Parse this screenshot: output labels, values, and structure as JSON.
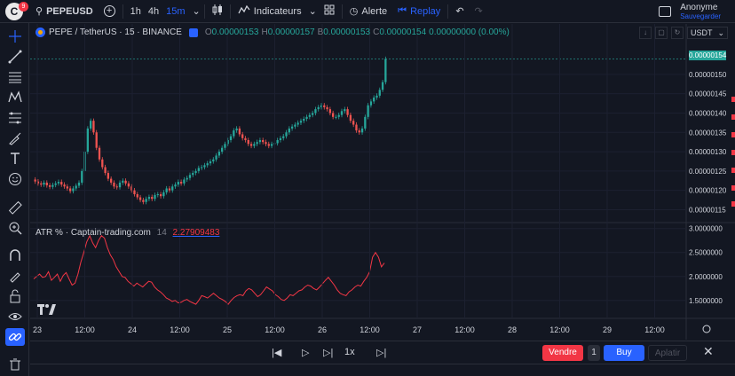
{
  "topbar": {
    "symbol": "PEPEUSD",
    "timeframes": [
      "1h",
      "4h",
      "15m"
    ],
    "indicators_label": "Indicateurs",
    "alert_label": "Alerte",
    "replay_label": "Replay",
    "user_name": "Anonyme",
    "user_sub": "Sauvegarder"
  },
  "legend": {
    "title": "PEPE / TetherUS · 15 · BINANCE",
    "o_label": "O",
    "o_val": "0.00000153",
    "h_label": "H",
    "h_val": "0.00000157",
    "b_label": "B",
    "b_val": "0.00000153",
    "c_label": "C",
    "c_val": "0.00000154",
    "change": "0.00000000 (0.00%)"
  },
  "indicator": {
    "name": "ATR % · Captain-trading.com",
    "length": "14",
    "value": "2.27909483"
  },
  "currency": "USDT",
  "price_tag": "0.00000154",
  "chart_data": [
    {
      "type": "candlestick",
      "title": "PEPE / TetherUS · 15 · BINANCE",
      "y_ticks": [
        "0.00000150",
        "0.00000145",
        "0.00000140",
        "0.00000135",
        "0.00000130",
        "0.00000125",
        "0.00000120",
        "0.00000115"
      ],
      "ylim": [
        1.135e-06,
        1.58e-06
      ],
      "x_ticks": [
        "23",
        "12:00",
        "24",
        "12:00",
        "25",
        "12:00",
        "26",
        "12:00",
        "27",
        "12:00",
        "28",
        "12:00",
        "29",
        "12:00"
      ],
      "close": [
        1.223,
        1.218,
        1.215,
        1.22,
        1.213,
        1.209,
        1.214,
        1.218,
        1.222,
        1.215,
        1.21,
        1.205,
        1.198,
        1.205,
        1.212,
        1.22,
        1.25,
        1.3,
        1.36,
        1.38,
        1.35,
        1.31,
        1.28,
        1.26,
        1.245,
        1.23,
        1.22,
        1.21,
        1.208,
        1.22,
        1.225,
        1.218,
        1.21,
        1.2,
        1.19,
        1.182,
        1.175,
        1.17,
        1.178,
        1.183,
        1.178,
        1.188,
        1.19,
        1.185,
        1.195,
        1.205,
        1.2,
        1.21,
        1.215,
        1.222,
        1.218,
        1.228,
        1.232,
        1.24,
        1.245,
        1.25,
        1.258,
        1.26,
        1.265,
        1.27,
        1.275,
        1.28,
        1.29,
        1.3,
        1.31,
        1.32,
        1.33,
        1.34,
        1.355,
        1.36,
        1.345,
        1.335,
        1.33,
        1.32,
        1.315,
        1.32,
        1.325,
        1.33,
        1.325,
        1.32,
        1.315,
        1.32,
        1.322,
        1.33,
        1.335,
        1.34,
        1.35,
        1.36,
        1.365,
        1.37,
        1.375,
        1.38,
        1.385,
        1.39,
        1.395,
        1.4,
        1.41,
        1.415,
        1.42,
        1.415,
        1.41,
        1.4,
        1.39,
        1.39,
        1.395,
        1.405,
        1.41,
        1.395,
        1.38,
        1.37,
        1.355,
        1.35,
        1.36,
        1.39,
        1.42,
        1.43,
        1.44,
        1.445,
        1.46,
        1.48,
        1.54
      ],
      "scale_note": "values in units of 0.000001"
    },
    {
      "type": "line",
      "title": "ATR % · Captain-trading.com 14",
      "y_ticks": [
        "3.0000000",
        "2.5000000",
        "2.0000000",
        "1.5000000"
      ],
      "ylim": [
        1.2,
        3.05
      ],
      "values": [
        1.95,
        2.0,
        2.05,
        1.98,
        2.0,
        2.1,
        1.92,
        1.98,
        2.05,
        1.9,
        2.02,
        2.08,
        1.95,
        1.82,
        1.86,
        2.05,
        2.3,
        2.5,
        2.72,
        2.85,
        2.7,
        2.6,
        2.75,
        2.85,
        2.8,
        2.6,
        2.45,
        2.35,
        2.2,
        2.1,
        2.0,
        1.98,
        1.9,
        1.85,
        1.8,
        1.86,
        1.82,
        1.78,
        1.84,
        1.9,
        1.88,
        1.78,
        1.72,
        1.68,
        1.62,
        1.55,
        1.52,
        1.48,
        1.5,
        1.45,
        1.46,
        1.5,
        1.52,
        1.48,
        1.45,
        1.42,
        1.5,
        1.6,
        1.58,
        1.55,
        1.6,
        1.65,
        1.6,
        1.55,
        1.52,
        1.48,
        1.42,
        1.5,
        1.56,
        1.6,
        1.62,
        1.6,
        1.7,
        1.75,
        1.72,
        1.65,
        1.58,
        1.62,
        1.7,
        1.78,
        1.74,
        1.7,
        1.62,
        1.58,
        1.52,
        1.5,
        1.55,
        1.62,
        1.6,
        1.65,
        1.7,
        1.72,
        1.78,
        1.82,
        1.8,
        1.75,
        1.72,
        1.78,
        1.85,
        1.92,
        1.98,
        1.9,
        1.82,
        1.72,
        1.65,
        1.62,
        1.6,
        1.68,
        1.72,
        1.78,
        1.82,
        1.8,
        1.9,
        1.98,
        2.1,
        2.4,
        2.5,
        2.4,
        2.2,
        2.28
      ]
    }
  ],
  "bottombar": {
    "speed": "1x",
    "sell_label": "Vendre",
    "qty": "1",
    "buy_label": "Buy",
    "flatten_label": "Aplatir"
  },
  "colors": {
    "bg": "#131722",
    "up": "#26a69a",
    "down": "#ef5350",
    "accent": "#2962ff",
    "atr_line": "#f23645",
    "sell": "#f23645",
    "buy": "#2962ff"
  }
}
